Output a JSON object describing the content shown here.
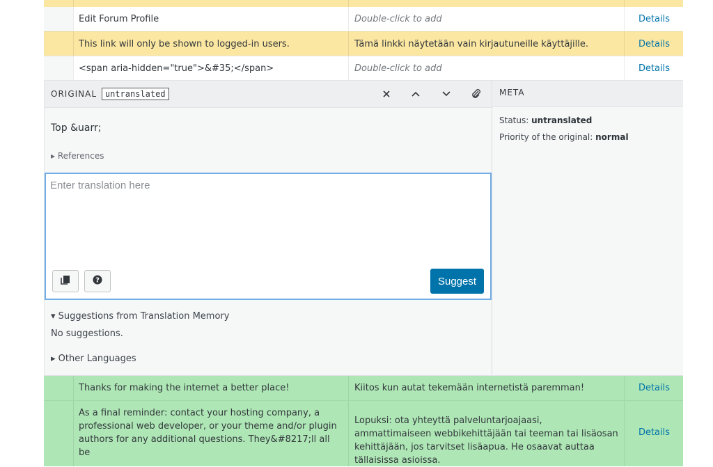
{
  "rows_top": [
    {
      "original": "Edit Forum Profile",
      "translation": "Double-click to add",
      "action": "Details",
      "status": "untranslated"
    },
    {
      "original": "This link will only be shown to logged-in users.",
      "translation": "Tämä linkki näytetään vain kirjautuneille käyttäjille.",
      "action": "Details",
      "status": "waiting"
    },
    {
      "original": "<span aria-hidden=\"true\">&#35;</span>",
      "translation": "Double-click to add",
      "action": "Details",
      "status": "untranslated"
    }
  ],
  "editor": {
    "original_label": "ORIGINAL",
    "status_badge": "untranslated",
    "original_text": "Top &uarr;",
    "references_label": "▸ References",
    "textarea_placeholder": "Enter translation here",
    "suggest_label": "Suggest",
    "tm_heading": "▾ Suggestions from Translation Memory",
    "tm_empty": "No suggestions.",
    "other_languages": "▸ Other Languages"
  },
  "meta": {
    "heading": "META",
    "status_label": "Status:",
    "status_value": "untranslated",
    "priority_label": "Priority of the original:",
    "priority_value": "normal"
  },
  "rows_bottom": [
    {
      "original": "Thanks for making the internet a better place!",
      "translation": "Kiitos kun autat tekemään internetistä paremman!",
      "action": "Details",
      "status": "current"
    },
    {
      "original": "As a final reminder: contact your hosting company, a professional web developer, or your theme and/or plugin authors for any additional questions. They&#8217;ll all be",
      "translation": "Lopuksi: ota yhteyttä palveluntarjoajaasi, ammattimaiseen webbikehittäjään tai teeman tai lisäosan kehittäjään, jos tarvitset lisäapua. He osaavat auttaa tällaisissa asioissa.",
      "action": "Details",
      "status": "current"
    }
  ],
  "colors": {
    "waiting_row": "#fbe7a1",
    "current_row": "#aee6b5",
    "accent": "#0073aa",
    "focus_border": "#72aee6"
  }
}
